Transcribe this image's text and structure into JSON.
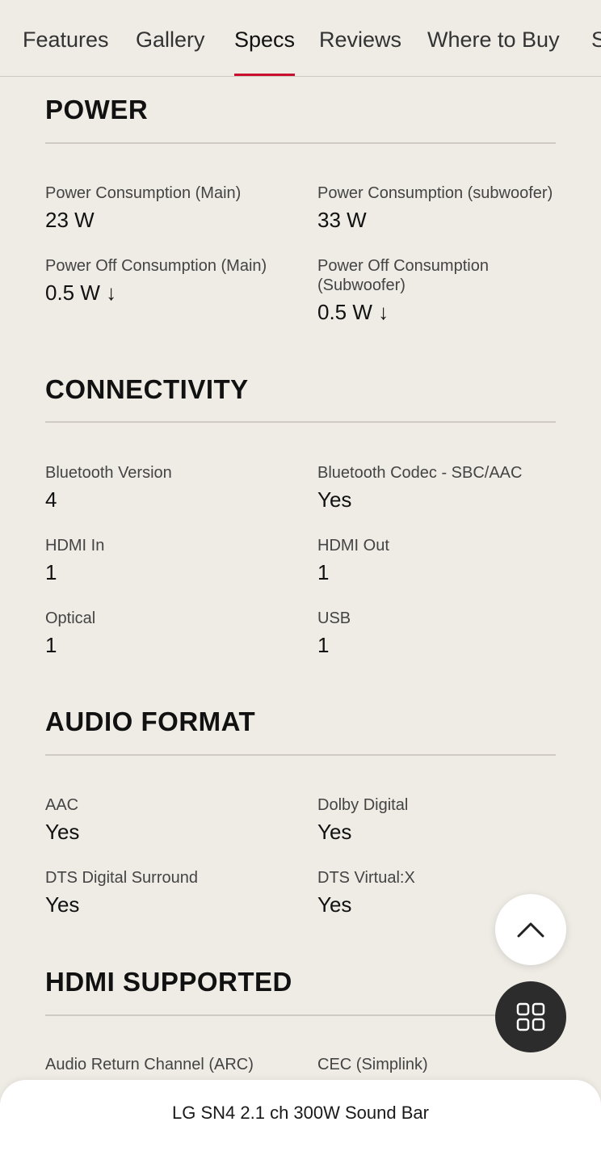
{
  "tabs": [
    {
      "label": "Features"
    },
    {
      "label": "Gallery"
    },
    {
      "label": "Specs",
      "active": true
    },
    {
      "label": "Reviews"
    },
    {
      "label": "Where to Buy"
    },
    {
      "label": "S"
    }
  ],
  "accent_color": "#c8102e",
  "sections": {
    "power": {
      "title": "POWER",
      "specs": [
        {
          "label": "Power Consumption (Main)",
          "value": "23 W"
        },
        {
          "label": "Power Consumption (subwoofer)",
          "value": "33 W"
        },
        {
          "label": "Power Off Consumption (Main)",
          "value": "0.5 W ↓"
        },
        {
          "label": "Power Off Consumption (Subwoofer)",
          "value": "0.5 W ↓"
        }
      ]
    },
    "connectivity": {
      "title": "CONNECTIVITY",
      "specs": [
        {
          "label": "Bluetooth Version",
          "value": "4"
        },
        {
          "label": "Bluetooth Codec - SBC/AAC",
          "value": "Yes"
        },
        {
          "label": "HDMI In",
          "value": "1"
        },
        {
          "label": "HDMI Out",
          "value": "1"
        },
        {
          "label": "Optical",
          "value": "1"
        },
        {
          "label": "USB",
          "value": "1"
        }
      ]
    },
    "audio_format": {
      "title": "AUDIO FORMAT",
      "specs": [
        {
          "label": "AAC",
          "value": "Yes"
        },
        {
          "label": "Dolby Digital",
          "value": "Yes"
        },
        {
          "label": "DTS Digital Surround",
          "value": "Yes"
        },
        {
          "label": "DTS Virtual:X",
          "value": "Yes"
        }
      ]
    },
    "hdmi_supported": {
      "title": "HDMI SUPPORTED",
      "specs": [
        {
          "label": "Audio Return Channel (ARC)"
        },
        {
          "label": "CEC (Simplink)"
        }
      ]
    }
  },
  "buttons": {
    "scroll_top_icon": "chevron-up-icon",
    "menu_icon": "grid-icon"
  },
  "bottom_bar": {
    "product_name": "LG SN4 2.1 ch 300W Sound Bar"
  }
}
